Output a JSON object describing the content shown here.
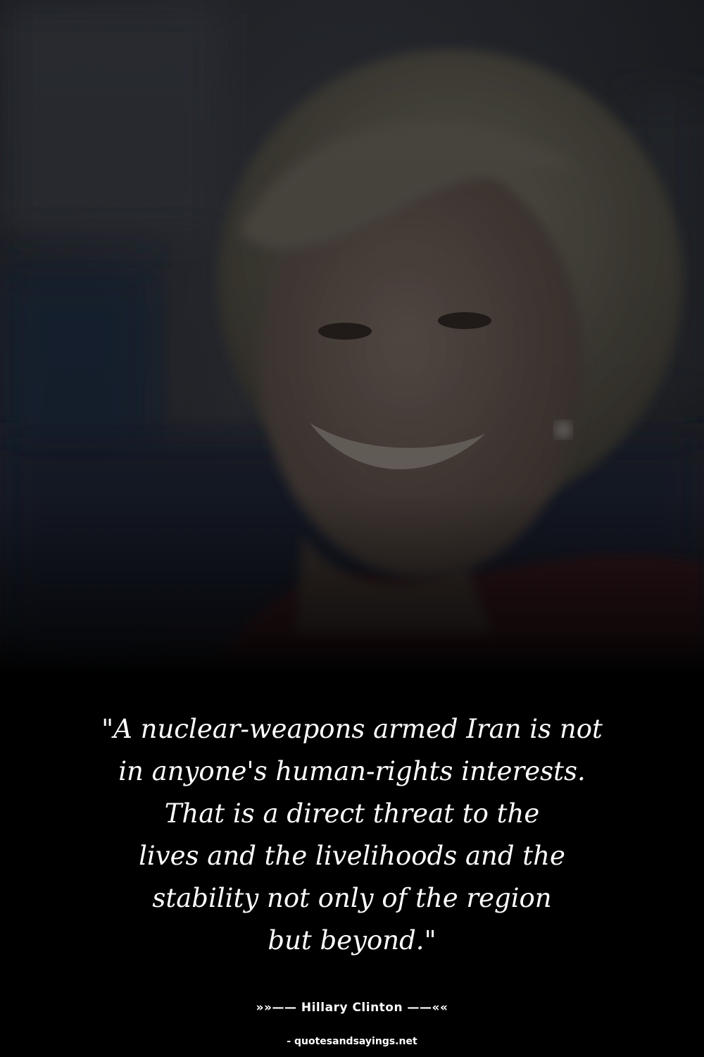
{
  "quote": {
    "lines": [
      "\"A nuclear-weapons armed Iran is not",
      "in anyone's human-rights interests.",
      "That is a direct threat to the",
      "lives and the livelihoods and the",
      "stability not only of the region",
      "but beyond.\""
    ]
  },
  "author": {
    "text": "»»—— Hillary Clinton ——««"
  },
  "source": {
    "text": "- quotesandsayings.net"
  },
  "colors": {
    "text": "#ffffff",
    "background": "#000000"
  }
}
